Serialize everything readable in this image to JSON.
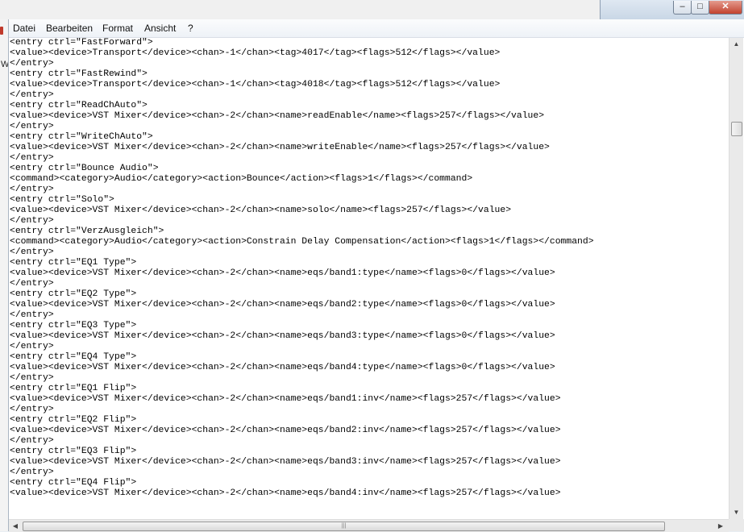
{
  "menu": {
    "items": [
      "Datei",
      "Bearbeiten",
      "Format",
      "Ansicht",
      "?"
    ]
  },
  "background": {
    "partial_text": "W"
  },
  "window_controls": {
    "minimize": "–",
    "maximize": "□",
    "close": "✕"
  },
  "editor": {
    "lines": [
      "<entry ctrl=\"FastForward\">",
      "<value><device>Transport</device><chan>-1</chan><tag>4017</tag><flags>512</flags></value>",
      "</entry>",
      "<entry ctrl=\"FastRewind\">",
      "<value><device>Transport</device><chan>-1</chan><tag>4018</tag><flags>512</flags></value>",
      "</entry>",
      "<entry ctrl=\"ReadChAuto\">",
      "<value><device>VST Mixer</device><chan>-2</chan><name>readEnable</name><flags>257</flags></value>",
      "</entry>",
      "<entry ctrl=\"WriteChAuto\">",
      "<value><device>VST Mixer</device><chan>-2</chan><name>writeEnable</name><flags>257</flags></value>",
      "</entry>",
      "<entry ctrl=\"Bounce Audio\">",
      "<command><category>Audio</category><action>Bounce</action><flags>1</flags></command>",
      "</entry>",
      "<entry ctrl=\"Solo\">",
      "<value><device>VST Mixer</device><chan>-2</chan><name>solo</name><flags>257</flags></value>",
      "</entry>",
      "<entry ctrl=\"VerzAusgleich\">",
      "<command><category>Audio</category><action>Constrain Delay Compensation</action><flags>1</flags></command>",
      "</entry>",
      "<entry ctrl=\"EQ1 Type\">",
      "<value><device>VST Mixer</device><chan>-2</chan><name>eqs/band1:type</name><flags>0</flags></value>",
      "</entry>",
      "<entry ctrl=\"EQ2 Type\">",
      "<value><device>VST Mixer</device><chan>-2</chan><name>eqs/band2:type</name><flags>0</flags></value>",
      "</entry>",
      "<entry ctrl=\"EQ3 Type\">",
      "<value><device>VST Mixer</device><chan>-2</chan><name>eqs/band3:type</name><flags>0</flags></value>",
      "</entry>",
      "<entry ctrl=\"EQ4 Type\">",
      "<value><device>VST Mixer</device><chan>-2</chan><name>eqs/band4:type</name><flags>0</flags></value>",
      "</entry>",
      "<entry ctrl=\"EQ1 Flip\">",
      "<value><device>VST Mixer</device><chan>-2</chan><name>eqs/band1:inv</name><flags>257</flags></value>",
      "</entry>",
      "<entry ctrl=\"EQ2 Flip\">",
      "<value><device>VST Mixer</device><chan>-2</chan><name>eqs/band2:inv</name><flags>257</flags></value>",
      "</entry>",
      "<entry ctrl=\"EQ3 Flip\">",
      "<value><device>VST Mixer</device><chan>-2</chan><name>eqs/band3:inv</name><flags>257</flags></value>",
      "</entry>",
      "<entry ctrl=\"EQ4 Flip\">",
      "<value><device>VST Mixer</device><chan>-2</chan><name>eqs/band4:inv</name><flags>257</flags></value>"
    ]
  },
  "scrollbars": {
    "vertical_position": 0.16,
    "horizontal_grip": "|||"
  }
}
